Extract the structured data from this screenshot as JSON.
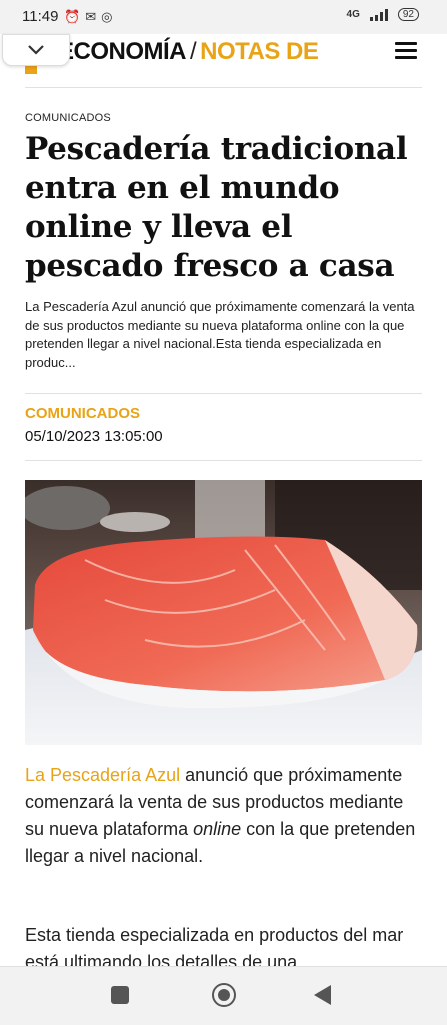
{
  "status_bar": {
    "time": "11:49",
    "left_icons": [
      "alarm-off-icon",
      "gmail-icon",
      "vpn-icon"
    ],
    "network": "4G",
    "battery": "92"
  },
  "header": {
    "brand": "ECONOMÍA",
    "separator": "/",
    "section": "NOTAS DE",
    "accent_color": "#e8a317"
  },
  "article": {
    "kicker": "COMUNICADOS",
    "headline": "Pescadería tradicional entra en el mundo online y lleva el pescado fresco a casa",
    "summary": "La Pescadería Azul anunció que próximamente comenzará la venta de sus productos mediante su nueva plataforma online con la que pretenden llegar a nivel nacional.Esta tienda especializada en produc...",
    "category": "COMUNICADOS",
    "date": "05/10/2023 13:05:00",
    "paragraph1": {
      "link": "La Pescadería Azul",
      "text1": " anunció que próximamente comenzará la venta de sus productos mediante su nueva plataforma ",
      "italic": "online",
      "text2": " con la que pretenden llegar a nivel nacional."
    },
    "paragraph2": "Esta tienda especializada en productos del mar está ultimando los detalles de una"
  },
  "nav_bar": {
    "buttons": [
      "recents-button",
      "home-button",
      "back-button"
    ]
  }
}
